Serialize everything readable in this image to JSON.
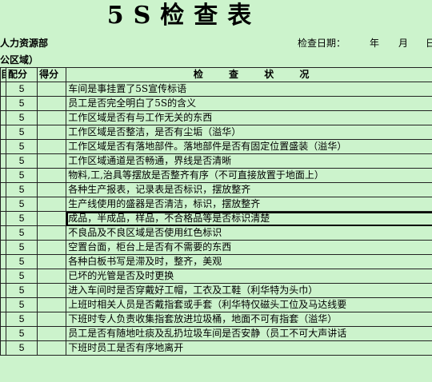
{
  "title": "5S检查表",
  "department": "人力资源部",
  "area": "公区域）",
  "check_date_label": "检查日期：",
  "year_label": "年",
  "month_label": "月",
  "day_label": "日",
  "headers": {
    "c0": "目",
    "score": "配分",
    "got": "得分",
    "status": "检 查 状 况"
  },
  "rows": [
    {
      "score": "5",
      "text": "车间是事挂置了5S宣传标语"
    },
    {
      "score": "5",
      "text": "员工是否完全明白了5S的含义"
    },
    {
      "score": "5",
      "text": "工作区域是否有与工作无关的东西"
    },
    {
      "score": "5",
      "text": "工作区域是否整洁，是否有尘垢（溢华）"
    },
    {
      "score": "5",
      "text": "工作区域是否有落地部件。落地部件是否有固定位置盛装（溢华）"
    },
    {
      "score": "5",
      "text": "工作区域通道是否畅通，界线是否清晰"
    },
    {
      "score": "5",
      "text": "物料,工,治具等摆放是否整齐有序（不可直接放置于地面上）"
    },
    {
      "score": "5",
      "text": "各种生产报表，记录表是否标识，摆放整齐"
    },
    {
      "score": "5",
      "text": "生产线使用的盛器是否清洁，标识，摆放整齐"
    },
    {
      "score": "5",
      "text": "成品，半成品，样品，不合格品等是否标识清楚"
    },
    {
      "score": "5",
      "text": "不良品及不良区域是否使用红色标识"
    },
    {
      "score": "5",
      "text": "空置台面，柜台上是否有不需要的东西"
    },
    {
      "score": "5",
      "text": "各种白板书写是滞及时，整齐，美观"
    },
    {
      "score": "5",
      "text": "已坏的光管是否及时更换"
    },
    {
      "score": "5",
      "text": "进入车间时是否穿戴好工帽，工衣及工鞋（利华特为头巾）"
    },
    {
      "score": "5",
      "text": "上班时相关人员是否戴指套或手套（利华特仅磁头工位及马达线要"
    },
    {
      "score": "5",
      "text": "下班时专人负责收集指套放进垃圾桶，地面不可有指套（溢华）"
    },
    {
      "score": "5",
      "text": "员工是否有随地吐痰及乱扔垃圾车间是否安静（员工不可大声讲话"
    },
    {
      "score": "5",
      "text": "下班时员工是否有序地离开"
    }
  ],
  "selected_row": 9
}
